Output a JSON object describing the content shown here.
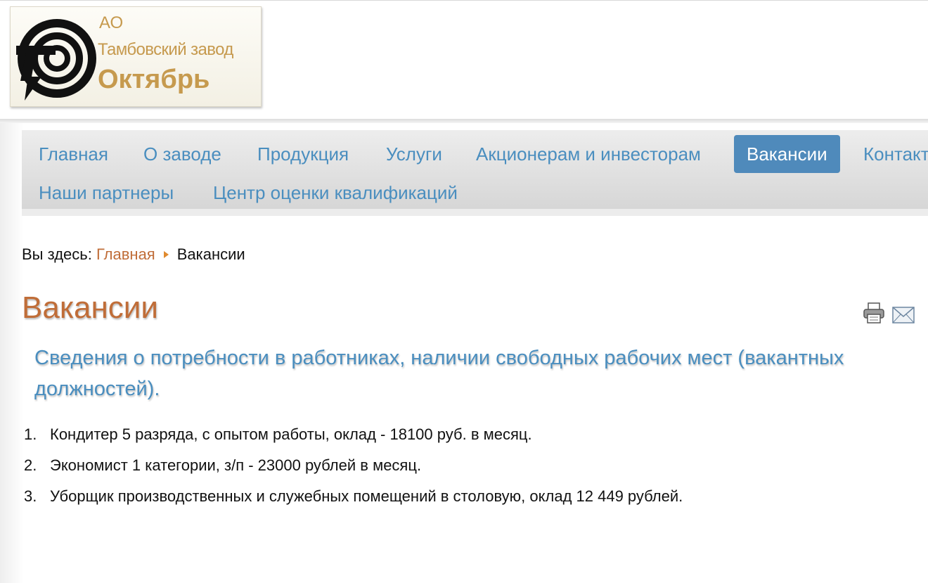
{
  "logo": {
    "line1": "АО",
    "line2": "Тамбовский завод",
    "line3": "Октябрь",
    "icon": "factory-emblem-icon"
  },
  "nav": {
    "items": [
      {
        "label": "Главная",
        "active": false
      },
      {
        "label": "О заводе",
        "active": false
      },
      {
        "label": "Продукция",
        "active": false
      },
      {
        "label": "Услуги",
        "active": false
      },
      {
        "label": "Акционерам и инвесторам",
        "active": false
      },
      {
        "label": "Вакансии",
        "active": true
      },
      {
        "label": "Контакт",
        "active": false
      },
      {
        "label": "Наши партнеры",
        "active": false
      },
      {
        "label": "Центр оценки квалификаций",
        "active": false
      }
    ]
  },
  "breadcrumb": {
    "prefix": "Вы здесь:",
    "home": "Главная",
    "current": "Вакансии"
  },
  "article": {
    "title": "Вакансии",
    "subtitle": "Сведения о потребности в работниках, наличии свободных рабочих мест (вакантных должностей).",
    "icons": [
      "print-icon",
      "email-icon"
    ],
    "vacancies": [
      {
        "num": "1.",
        "text": "Кондитер 5 разряда, с опытом работы, оклад - 18100 руб. в месяц."
      },
      {
        "num": "2.",
        "text": "Экономист 1 категории, з/п - 23000 рублей в месяц."
      },
      {
        "num": "3.",
        "text": "Уборщик производственных и служебных помещений в столовую, оклад 12 449 рублей."
      }
    ]
  },
  "colors": {
    "accent_orange": "#c06d38",
    "link_blue": "#4a8ebf",
    "active_tab": "#4f8abb",
    "logo_gold": "#c69a4e"
  }
}
